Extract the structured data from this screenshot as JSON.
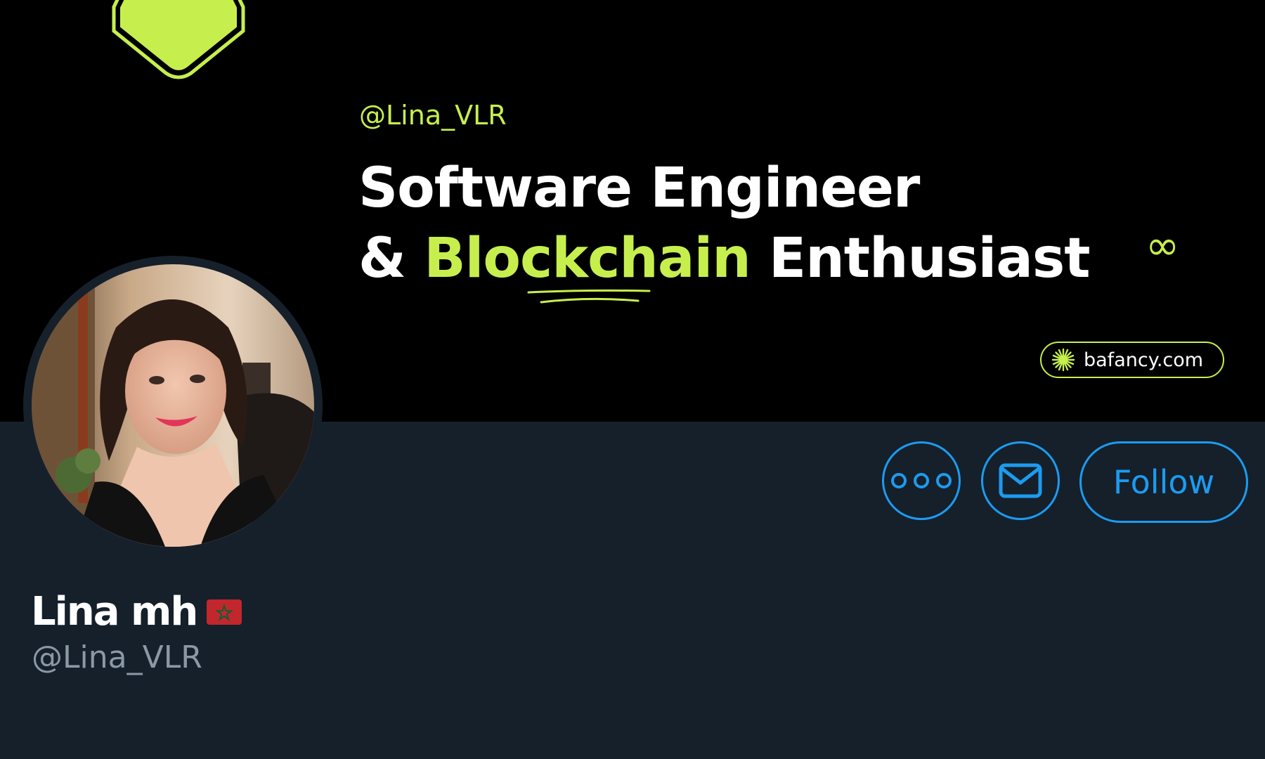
{
  "banner": {
    "handle": "@Lina_VLR",
    "headline_line1": "Software Engineer",
    "headline_amp": "& ",
    "headline_highlight": "Blockchain",
    "headline_rest": " Enthusiast",
    "infinity_symbol": "∞",
    "website": "bafancy.com",
    "accent_color": "#c6ef4e"
  },
  "actions": {
    "more_icon": "more-icon",
    "message_icon": "mail-icon",
    "follow_label": "Follow",
    "accent_color": "#1d9bf0"
  },
  "profile": {
    "name": "Lina mh",
    "flag_icon": "morocco-flag-icon",
    "handle": "@Lina_VLR"
  },
  "colors": {
    "background": "#15202b",
    "banner": "#000000",
    "secondary_text": "#8b98a5"
  }
}
